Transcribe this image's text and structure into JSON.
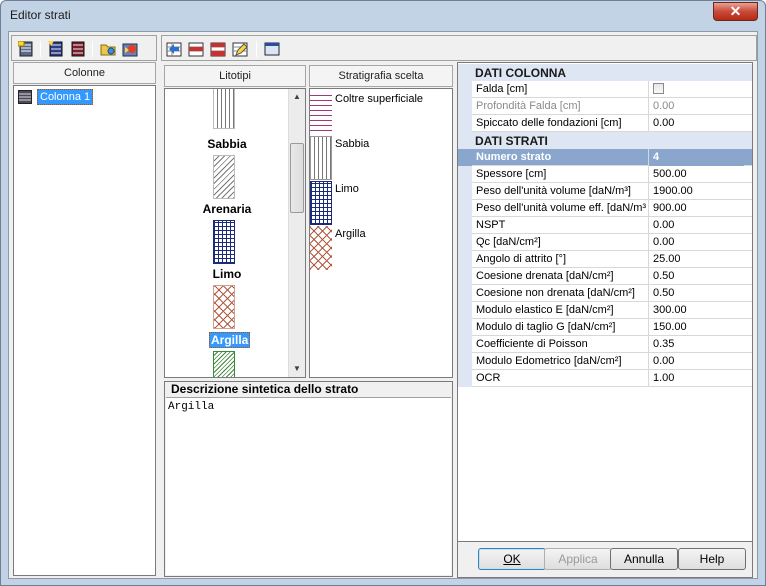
{
  "window": {
    "title": "Editor strati",
    "close_glyph": "✕"
  },
  "toolbar1": {
    "icons": [
      "new-column-icon",
      "add-layer-icon",
      "delete-layer-icon",
      "open-folder-icon",
      "import-icon"
    ]
  },
  "toolbar2": {
    "icons": [
      "grid-add-icon",
      "grid-remove-icon",
      "grid-swap-icon",
      "grid-edit-icon",
      "window-icon"
    ]
  },
  "colonne": {
    "header": "Colonne",
    "items": [
      {
        "label": "Colonna 1",
        "selected": true
      }
    ]
  },
  "litotipi": {
    "header": "Litotipi",
    "items": [
      {
        "label": "Sabbia",
        "pattern": "vertical-lines"
      },
      {
        "label": "Arenaria",
        "pattern": "diagonal-lines"
      },
      {
        "label": "Limo",
        "pattern": "grid-blue"
      },
      {
        "label": "Argilla",
        "pattern": "crosshatch-brown",
        "selected": true
      },
      {
        "label": "",
        "pattern": "diagonal-green"
      }
    ]
  },
  "stratigrafia": {
    "header": "Stratigrafia scelta",
    "items": [
      {
        "label": "Coltre superficiale",
        "pattern": "horizontal-purple"
      },
      {
        "label": "Sabbia",
        "pattern": "vertical-lines"
      },
      {
        "label": "Limo",
        "pattern": "grid-blue"
      },
      {
        "label": "Argilla",
        "pattern": "crosshatch-brown"
      }
    ]
  },
  "descrizione": {
    "header": "Descrizione sintetica dello strato",
    "text": "Argilla"
  },
  "props": {
    "cat1": "DATI COLONNA",
    "colonna": [
      {
        "key": "Falda [cm]",
        "value": "",
        "checkbox": true
      },
      {
        "key": "Profondità Falda [cm]",
        "value": "0.00",
        "disabled": true
      },
      {
        "key": "Spiccato delle fondazioni [cm]",
        "value": "0.00"
      }
    ],
    "cat2": "DATI STRATI",
    "strati": [
      {
        "key": "Numero strato",
        "value": "4",
        "highlight": true
      },
      {
        "key": "Spessore [cm]",
        "value": "500.00"
      },
      {
        "key": "Peso dell'unità volume [daN/m³]",
        "value": "1900.00"
      },
      {
        "key": "Peso dell'unità volume eff. [daN/m³]",
        "value": "900.00"
      },
      {
        "key": "NSPT",
        "value": "0.00"
      },
      {
        "key": "Qc [daN/cm²]",
        "value": "0.00"
      },
      {
        "key": "Angolo di attrito [°]",
        "value": "25.00"
      },
      {
        "key": "Coesione drenata [daN/cm²]",
        "value": "0.50"
      },
      {
        "key": "Coesione non drenata [daN/cm²]",
        "value": "0.50"
      },
      {
        "key": "Modulo elastico E [daN/cm²]",
        "value": "300.00"
      },
      {
        "key": "Modulo di taglio G [daN/cm²]",
        "value": "150.00"
      },
      {
        "key": "Coefficiente di Poisson",
        "value": "0.35"
      },
      {
        "key": "Modulo Edometrico [daN/cm²]",
        "value": "0.00"
      },
      {
        "key": "OCR",
        "value": "1.00"
      }
    ]
  },
  "buttons": {
    "ok": "OK",
    "applica": "Applica",
    "annulla": "Annulla",
    "help": "Help"
  },
  "colors": {
    "highlight": "#3399ff",
    "category_bg": "#dde6f2",
    "row_highlight": "#8aa6cc"
  }
}
